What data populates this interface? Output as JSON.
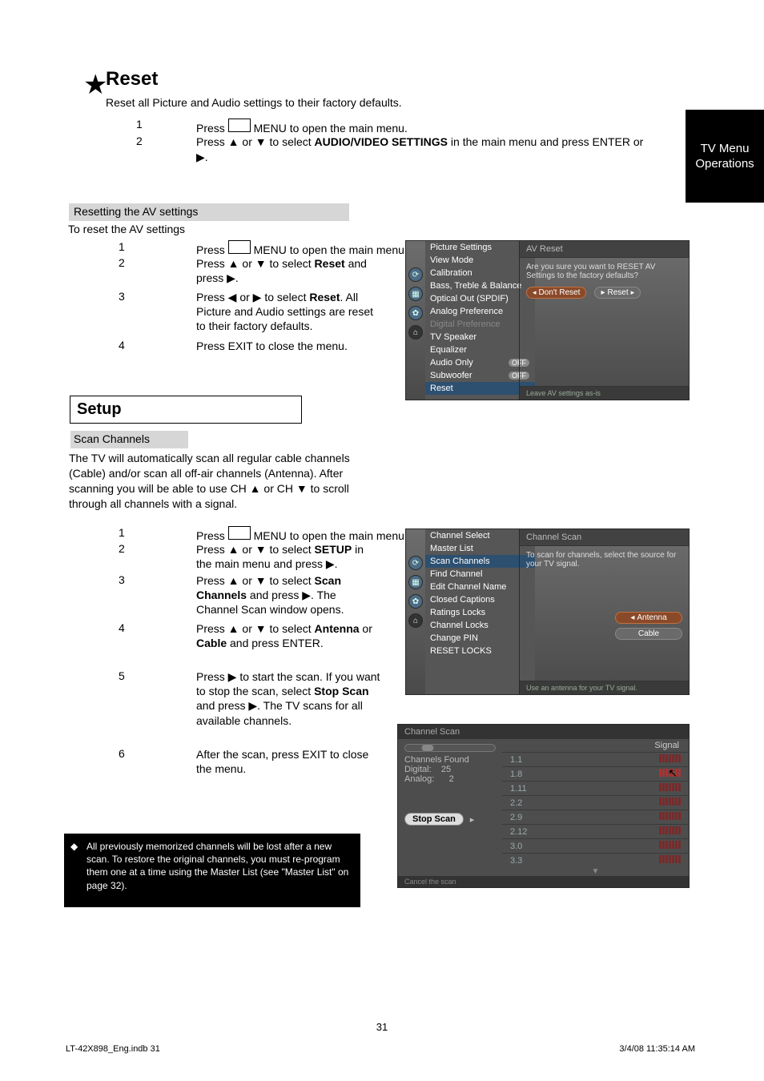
{
  "sideTab": {
    "l1": "TV Menu",
    "l2": "Operations"
  },
  "reset": {
    "star": "★",
    "title": "Reset",
    "sub": "Reset all Picture and Audio settings to their factory defaults.",
    "s1n": "1",
    "s1": "Press MENU to open the main menu.",
    "s2n": "2",
    "s2a": "Press ▲ or ▼ to select ",
    "s2b": "AUDIO/VIDEO SETTINGS",
    "s2c": " in the main menu and press ENTER or ▶.",
    "barTitle": "Resetting the AV settings",
    "barDesc": "To reset the AV settings",
    "b1n": "1",
    "b1": "Press MENU to open the main menu.",
    "b2n": "2",
    "b2a": "Press ▲ or ▼ to select ",
    "b2b": "Reset",
    "b2c": " and press ▶.",
    "b3n": "3",
    "b3a": "Press ◀ or ▶ to select ",
    "b3b": "Reset",
    "b3c": ". All Picture and Audio settings are reset to their factory defaults.",
    "b4n": "4",
    "b4": "Press EXIT to close the menu."
  },
  "setupTitle": "Setup",
  "scan": {
    "bar": "Scan Channels",
    "intro": "The TV will automatically scan all regular cable channels (Cable) and/or scan all off-air channels (Antenna). After scanning you will be able to use CH ▲ or CH ▼ to scroll through all channels with a signal.",
    "c1n": "1",
    "c1": "Press MENU to open the main menu.",
    "c2n": "2",
    "c2a": "Press ▲ or ▼ to select ",
    "c2b": "SETUP",
    "c2c": " in the main menu and press ▶.",
    "c3n": "3",
    "c3a": "Press ▲ or ▼ to select ",
    "c3b": "Scan Channels",
    "c3c": " and press ▶. The Channel Scan window opens.",
    "c4n": "4",
    "c4a": "Press ▲ or ▼ to select ",
    "c4b": "Antenna",
    "c4c": " or ",
    "c4d": "Cable",
    "c4e": " and press ENTER.",
    "c5n": "5",
    "c5a": "Press ▶ to start the scan. If you want to stop the scan, select ",
    "c5b": "Stop Scan",
    "c5c": " and press ▶. The TV scans for all available channels.",
    "c6n": "6",
    "c6": "After the scan, press EXIT to close the menu."
  },
  "note": {
    "text": "All previously memorized channels will be lost after a new scan. To restore the original channels, you must re-program them one at a time using the Master List (see \"Master List\" on page 32)."
  },
  "osd1": {
    "menuItems": [
      "Picture Settings",
      "View Mode",
      "Calibration",
      "Bass, Treble & Balance",
      "Optical Out (SPDIF)",
      "Analog Preference",
      "Digital Preference",
      "TV Speaker",
      "Equalizer",
      "Audio Only",
      "Subwoofer",
      "Reset"
    ],
    "pillA": "OFF",
    "pillB": "OFF",
    "panelTitle": "AV Reset",
    "panelMsg": "Are you sure you want to RESET AV Settings to the factory defaults?",
    "btnDont": "Don't Reset",
    "btnReset": "Reset",
    "hint": "Leave AV settings as-is"
  },
  "osd2": {
    "menuItems": [
      "Channel Select",
      "Master List",
      "Scan Channels",
      "Find Channel",
      "Edit Channel Name",
      "Closed Captions",
      "Ratings Locks",
      "Channel Locks",
      "Change PIN",
      "RESET LOCKS"
    ],
    "panelTitle": "Channel Scan",
    "panelMsg": "To scan for channels, select the source for your TV signal.",
    "btnAnt": "Antenna",
    "btnCab": "Cable",
    "hint": "Use an antenna for your TV signal."
  },
  "scanbox": {
    "title": "Channel Scan",
    "signalHdr": "Signal",
    "found": "Channels Found",
    "digLabel": "Digital:",
    "digVal": "25",
    "anaLabel": "Analog:",
    "anaVal": "2",
    "rows": [
      "1.1",
      "1.8",
      "1.11",
      "2.2",
      "2.9",
      "2.12",
      "3.0",
      "3.3"
    ],
    "stop": "Stop Scan",
    "hint": "Cancel the scan"
  },
  "footer": {
    "left": "LT-42X898_Eng.indb   31",
    "right": "3/4/08   11:35:14 AM",
    "page": "31"
  }
}
